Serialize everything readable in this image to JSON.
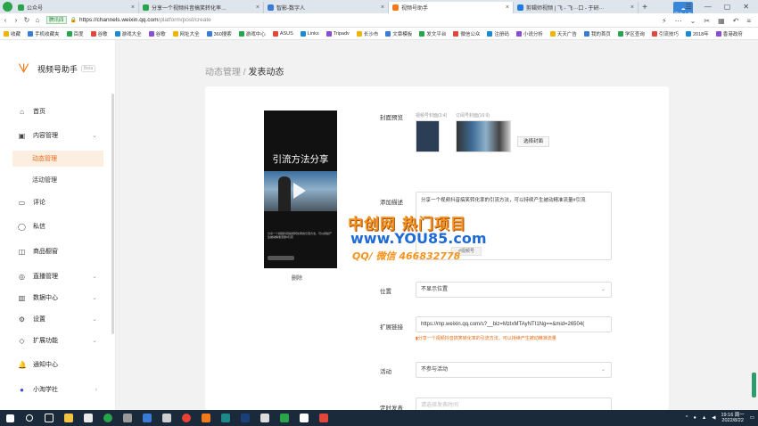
{
  "browser": {
    "tabs": [
      {
        "label": "公众号",
        "color": "#2aa44a"
      },
      {
        "label": "分享一个视频抖音搞笑转化率…",
        "color": "#2aa44a"
      },
      {
        "label": "智影-数字人",
        "color": "#3a7bd5"
      },
      {
        "label": "视频号助手",
        "color": "#f27a1a",
        "active": true
      },
      {
        "label": "剪辑师视频 | 飞 - 飞···口 - 于研···",
        "color": "#1f7ae0"
      }
    ],
    "winbadge": "同步上传",
    "site_badge": "腾讯四",
    "url_host": "https://channels.weixin.qq.com",
    "url_path": "/platform/post/create",
    "bookmarks": [
      "收藏",
      "手机收藏夹",
      "百度",
      "谷歌",
      "游戏大全",
      "谷歌",
      "网址大全",
      "360搜索",
      "游戏中心",
      "ASUS",
      "Links",
      "Tripadv",
      "长沙市",
      "文章模板",
      "发文平台",
      "微信公众",
      "注册码",
      "小说分析",
      "天天广告",
      "我的首页",
      "学区查询",
      "引流技巧",
      "2018年",
      "香港政府"
    ]
  },
  "sidebar": {
    "brand": "视频号助手",
    "beta": "Beta",
    "items": [
      {
        "label": "首页",
        "icon": "home-icon",
        "glyph": "⌂"
      },
      {
        "label": "内容管理",
        "icon": "content-icon",
        "glyph": "▣",
        "chev": "⌄"
      },
      {
        "label": "评论",
        "icon": "comment-icon",
        "glyph": "▭"
      },
      {
        "label": "私信",
        "icon": "message-icon",
        "glyph": "◯"
      },
      {
        "label": "商品橱窗",
        "icon": "bag-icon",
        "glyph": "◫"
      },
      {
        "label": "直播管理",
        "icon": "live-icon",
        "glyph": "◎",
        "chev": "⌄"
      },
      {
        "label": "数据中心",
        "icon": "data-icon",
        "glyph": "▥",
        "chev": "⌄"
      },
      {
        "label": "设置",
        "icon": "gear-icon",
        "glyph": "⚙",
        "chev": "⌄"
      },
      {
        "label": "扩展功能",
        "icon": "extension-icon",
        "glyph": "◇",
        "chev": "⌄"
      },
      {
        "label": "通知中心",
        "icon": "bell-icon",
        "glyph": "🔔"
      },
      {
        "label": "小淘学社",
        "icon": "avatar-icon",
        "glyph": "●",
        "chev": "›"
      }
    ],
    "subitems": [
      "动态管理",
      "活动管理"
    ]
  },
  "breadcrumb": {
    "parent": "动态管理",
    "sep": " / ",
    "current": "发表动态"
  },
  "preview": {
    "title": "引流方法分享",
    "delete": "删除"
  },
  "form": {
    "cover_label": "封面预览",
    "cover_tab1": "视频号封面(3:4)",
    "cover_tab2": "订阅号封面(16:9)",
    "cover_btn": "选择封面",
    "desc_label": "添加描述",
    "desc_text": "分享一个视频抖音搞笑转化率的引流方法，可以持续产生被动精准流量#引流",
    "topic_btn": "#视频号",
    "location_label": "位置",
    "location_value": "不显示位置",
    "link_label": "扩展链接",
    "link_value": "https://mp.weixin.qq.com/s?__biz=MzIxMTAyNTI1Ng==&mid=26504(",
    "link_hint": "分享一个视频抖音搞笑转化率的引流方法，可以持续产生被动精准流量",
    "activity_label": "活动",
    "activity_value": "不参与活动",
    "schedule_label": "定时发表",
    "schedule_placeholder": "请选择发表时间"
  },
  "watermark": {
    "line1": "中创网 热门项目",
    "line2": "www.YOU85.com",
    "line3": "QQ/ 微信 466832778"
  },
  "taskbar": {
    "time": "19:16 周一",
    "date": "2022/8/22"
  }
}
